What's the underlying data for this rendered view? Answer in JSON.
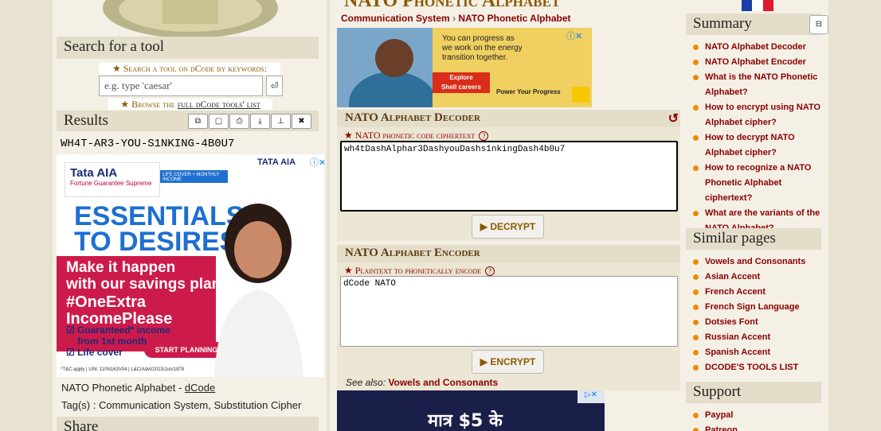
{
  "left": {
    "search_heading": "Search for a tool",
    "search_keywords_label": "Search a tool on dCode by keywords:",
    "search_placeholder": "e.g. type 'caesar'",
    "search_go": "⏎",
    "browse_prefix": "Browse the ",
    "browse_link": "full dCode tools' list",
    "results_heading": "Results",
    "result_value": "WH4T-AR3-YOU-S1NKING-4B0U7",
    "credit_text": "NATO Phonetic Alphabet - ",
    "credit_link": "dCode",
    "tags_text": "Tag(s) : Communication System, Substitution Cipher",
    "share_heading": "Share",
    "ad": {
      "brand": "Tata AIA",
      "sub": "Fortune Guarantee Supreme",
      "pill": "LIFE COVER + MONTHLY INCOME",
      "logo": "TATA AIA",
      "line1": "ESSENTIALS",
      "line2": "TO DESIRES",
      "line3": "Make it happen",
      "line4": "with our savings plan",
      "hashtag": "#OneExtra",
      "hashtag2": "IncomePlease",
      "b1": "Guaranteed* income",
      "b1b": "from 1st month",
      "b2": "Life cover",
      "cta": "START PLANNING",
      "fine": "*T&C apply | UIN: 110N163V04 | L&C/Advt/2023/Jun/1878"
    }
  },
  "mid": {
    "title": "NATO Phonetic Alphabet",
    "breadcrumb_1": "Communication System",
    "breadcrumb_sep": "›",
    "breadcrumb_2": "NATO Phonetic Alphabet",
    "ad": {
      "text1": "You can progress as",
      "text2": "we work on the energy",
      "text3": "transition together.",
      "cta1": "Explore",
      "cta2": "Shell careers",
      "footer": "Power Your Progress"
    },
    "decoder_heading": "NATO Alphabet Decoder",
    "decoder_label": "NATO phonetic code ciphertext",
    "decoder_value": "wh4tDashAlphar3DashyouDashs1nkingDash4b0u7",
    "decrypt_button": "▶ DECRYPT",
    "encoder_heading": "NATO Alphabet Encoder",
    "encoder_label": "Plaintext to phonetically encode",
    "encoder_value": "dCode NATO",
    "encrypt_button": "▶ ENCRYPT",
    "see_also_label": "See also: ",
    "see_also_link": "Vowels and Consonants",
    "ad_bottom_text": "मात्र $5 के"
  },
  "right": {
    "summary_heading": "Summary",
    "summary_toggle": "⊟",
    "summary_items": [
      "NATO Alphabet Decoder",
      "NATO Alphabet Encoder",
      "What is the NATO Phonetic Alphabet?",
      "How to encrypt using NATO Alphabet cipher?",
      "How to decrypt NATO Alphabet cipher?",
      "How to recognize a NATO Phonetic Alphabet ciphertext?",
      "What are the variants of the NATO Alphabet?"
    ],
    "similar_heading": "Similar pages",
    "similar_items": [
      "Vowels and Consonants",
      "Asian Accent",
      "French Accent",
      "French Sign Language",
      "Dotsies Font",
      "Russian Accent",
      "Spanish Accent",
      "DCODE'S TOOLS LIST"
    ],
    "support_heading": "Support",
    "support_items": [
      "Paypal",
      "Patreon"
    ]
  },
  "colors": {
    "accent": "#8a0000",
    "title": "#8a5a00",
    "bullet": "#f08a00",
    "panel": "#e4ddc9"
  }
}
